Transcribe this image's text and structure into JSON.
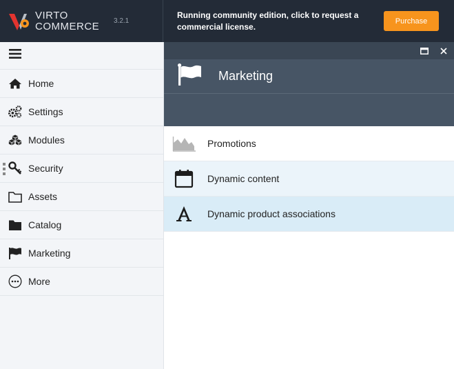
{
  "brand": {
    "line1": "VIRTO",
    "line2": "COMMERCE",
    "version": "3.2.1",
    "logo_colors": {
      "red": "#e3342f",
      "orange": "#f7941d"
    }
  },
  "notice": {
    "text": "Running community edition, click to request a commercial license.",
    "purchase_label": "Purchase",
    "purchase_color": "#f7941d"
  },
  "sidebar": {
    "menu_icon": "hamburger-icon",
    "items": [
      {
        "label": "Home",
        "icon": "home-icon"
      },
      {
        "label": "Settings",
        "icon": "gears-icon"
      },
      {
        "label": "Modules",
        "icon": "cubes-icon"
      },
      {
        "label": "Security",
        "icon": "key-icon"
      },
      {
        "label": "Assets",
        "icon": "folder-outline-icon"
      },
      {
        "label": "Catalog",
        "icon": "folder-icon"
      },
      {
        "label": "Marketing",
        "icon": "flag-icon"
      },
      {
        "label": "More",
        "icon": "ellipsis-circle-icon"
      }
    ]
  },
  "blade": {
    "title": "Marketing",
    "icon": "flag-icon",
    "controls": [
      "maximize-icon",
      "close-icon"
    ],
    "header_color": "#475565",
    "items": [
      {
        "label": "Promotions",
        "icon": "area-chart-icon"
      },
      {
        "label": "Dynamic content",
        "icon": "calendar-icon"
      },
      {
        "label": "Dynamic product associations",
        "icon": "font-icon"
      }
    ]
  }
}
